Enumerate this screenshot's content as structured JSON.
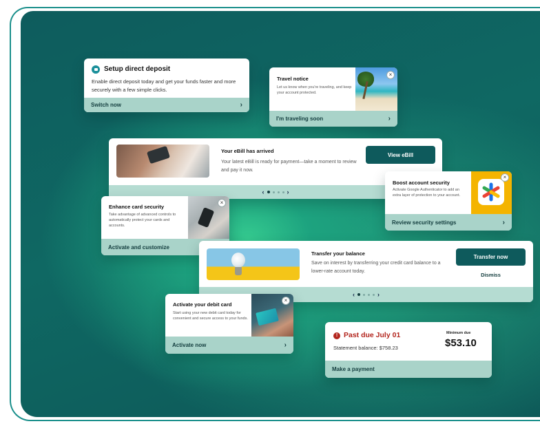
{
  "direct_deposit": {
    "title": "Setup direct deposit",
    "description": "Enable direct deposit today and get your funds faster and more securely with a few simple clicks.",
    "action": "Switch now"
  },
  "travel": {
    "title": "Travel notice",
    "description": "Let us know when you're traveling, and keep your account protected.",
    "action": "I'm traveling soon"
  },
  "ebill": {
    "title": "Your eBill has arrived",
    "description": "Your latest eBill is ready for payment—take a moment to review and pay it now.",
    "button": "View eBill"
  },
  "security": {
    "title": "Boost account security",
    "description": "Activate Google Authenticator to add an extra layer of protection to your account.",
    "action": "Review security settings"
  },
  "card_security": {
    "title": "Enhance card security",
    "description": "Take advantage of advanced controls to automatically protect your cards and accounts.",
    "action": "Activate and customize"
  },
  "transfer": {
    "title": "Transfer your balance",
    "description": "Save on interest by transferring your credit card balance to a lower-rate account today.",
    "button": "Transfer now",
    "dismiss": "Dismiss"
  },
  "debit": {
    "title": "Activate your debit card",
    "description": "Start using your new debit card today for convenient and secure access to your funds.",
    "action": "Activate now"
  },
  "past_due": {
    "title": "Past due July 01",
    "statement": "Statement balance: $758.23",
    "min_label": "Minimum due",
    "min_amount": "$53.10",
    "action": "Make a payment"
  },
  "colors": {
    "accent": "#0e5a5c",
    "footer": "#a9d3c9",
    "alert": "#b3261e"
  },
  "icons": {
    "close": "×",
    "chevron_right": "›",
    "chevron_left": "‹"
  }
}
